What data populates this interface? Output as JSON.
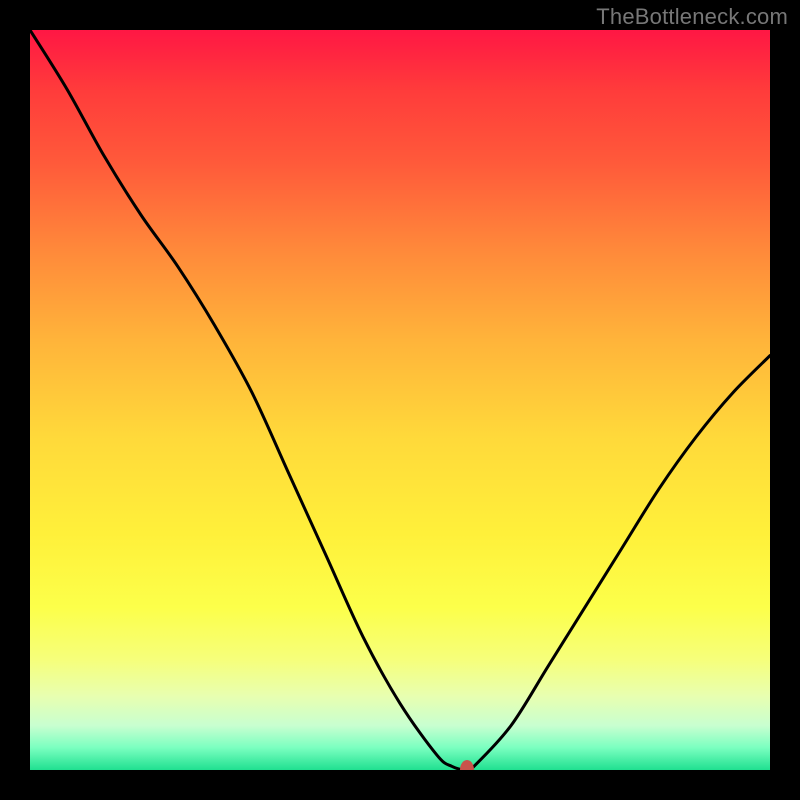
{
  "watermark": "TheBottleneck.com",
  "colors": {
    "background": "#000000",
    "gradient_top": "#ff1744",
    "gradient_bottom": "#20e090",
    "curve": "#000000",
    "marker": "#c9534b"
  },
  "chart_data": {
    "type": "line",
    "title": "",
    "xlabel": "",
    "ylabel": "",
    "xlim": [
      0,
      100
    ],
    "ylim": [
      0,
      100
    ],
    "grid": false,
    "legend": "",
    "x": [
      0,
      5,
      10,
      15,
      20,
      25,
      30,
      35,
      40,
      45,
      50,
      55,
      57,
      59,
      60,
      65,
      70,
      75,
      80,
      85,
      90,
      95,
      100
    ],
    "values": [
      100,
      92,
      83,
      75,
      68,
      60,
      51,
      40,
      29,
      18,
      9,
      2,
      0.5,
      0,
      0.5,
      6,
      14,
      22,
      30,
      38,
      45,
      51,
      56
    ],
    "marker": {
      "x": 59,
      "y": 0
    },
    "notes": "V-shaped bottleneck curve: steep descending left branch, short flat valley near x≈57–60, shallower ascending right branch. Values are approximate readings from an unlabeled gradient chart."
  }
}
